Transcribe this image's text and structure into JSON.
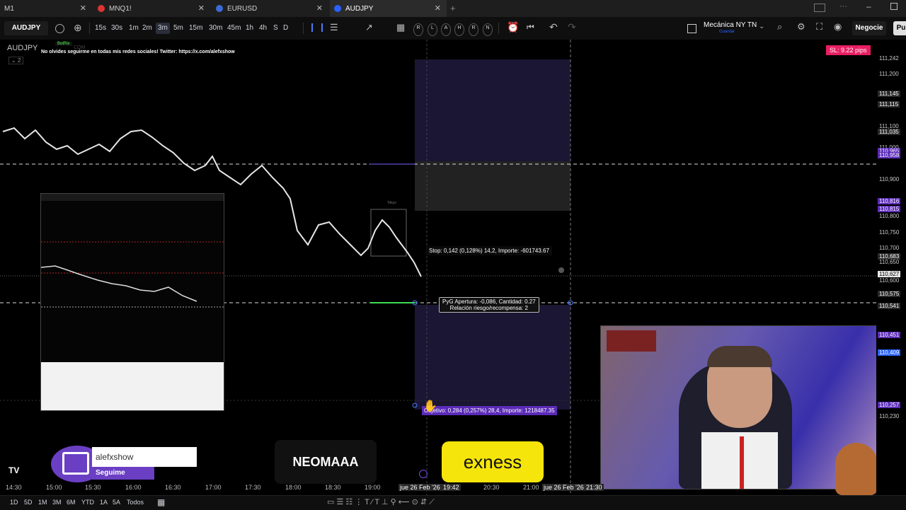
{
  "tabs": [
    {
      "label": "M1",
      "color": "#3a3a3a"
    },
    {
      "label": "MNQ1!",
      "color": "#2962ff"
    },
    {
      "label": "EURUSD",
      "color": "#2962ff"
    },
    {
      "label": "AUDJPY",
      "color": "#2962ff"
    }
  ],
  "toolbar": {
    "symbol": "AUDJPY",
    "intervals": [
      "15s",
      "30s",
      "1m",
      "2m",
      "3m",
      "5m",
      "15m",
      "30m",
      "45m",
      "1h",
      "4h",
      "S",
      "D"
    ],
    "active_interval": "3m",
    "drawing_letters": [
      "R",
      "L",
      "A",
      "H",
      "R",
      "N"
    ],
    "layout_name": "Mecánica NY TN",
    "layout_sub": "Guardar",
    "trade_button": "Negocie",
    "publish_button": "Pu"
  },
  "chart": {
    "legend_symbol": "AUDJPY",
    "legend_badge": "BotRix",
    "legend_small": "COM",
    "ticker_text": "No olvides seguirme en todas mis redes sociales! Twitter: https://x.com/alefxshow",
    "indicator_count": "2",
    "sl_badge": "SL: 9.22 pips",
    "stop_label": "Stop: 0,142 (0,128%) 14,2, Importe: -601743.67",
    "pyg_label_1": "PyG Apertura: -0,086, Cantidad: 0.27",
    "pyg_label_2": "Relación riesgo/recompensa: 2",
    "target_label": "Objetivo: 0,284 (0,257%) 28,4, Importe: 1218487.35",
    "session_label": "Tokyo"
  },
  "price_scale": [
    {
      "label": "111,242",
      "kind": "plain"
    },
    {
      "label": "111,200",
      "kind": "plain"
    },
    {
      "label": "111,145",
      "kind": "dark"
    },
    {
      "label": "111,115",
      "kind": "dark"
    },
    {
      "label": "111,100",
      "kind": "plain"
    },
    {
      "label": "111,035",
      "kind": "dark"
    },
    {
      "label": "111,000",
      "kind": "plain"
    },
    {
      "label": "110,965",
      "kind": "purple"
    },
    {
      "label": "110,958",
      "kind": "purple"
    },
    {
      "label": "110,900",
      "kind": "plain"
    },
    {
      "label": "110,816",
      "kind": "purple"
    },
    {
      "label": "110,815",
      "kind": "purple"
    },
    {
      "label": "110,800",
      "kind": "plain"
    },
    {
      "label": "110,750",
      "kind": "plain"
    },
    {
      "label": "110,700",
      "kind": "plain"
    },
    {
      "label": "110,683",
      "kind": "dark"
    },
    {
      "label": "110,650",
      "kind": "plain"
    },
    {
      "label": "110,627",
      "kind": "white"
    },
    {
      "label": "110,600",
      "kind": "plain"
    },
    {
      "label": "110,575",
      "kind": "dark"
    },
    {
      "label": "110,541",
      "kind": "dark"
    },
    {
      "label": "110,451",
      "kind": "purple"
    },
    {
      "label": "110,409",
      "kind": "blue"
    },
    {
      "label": "110,257",
      "kind": "purple"
    },
    {
      "label": "110,230",
      "kind": "plain"
    }
  ],
  "time_axis": [
    "14:30",
    "15:00",
    "15:30",
    "16:00",
    "16:30",
    "17:00",
    "17:30",
    "18:00",
    "18:30",
    "19:00",
    "jue 26 Feb '26",
    "19:42",
    "20:30",
    "21:00",
    "jue 26 Feb '26",
    "21:30"
  ],
  "bottom_bar": {
    "ranges": [
      "1D",
      "5D",
      "1M",
      "3M",
      "6M",
      "YTD",
      "1A",
      "5A",
      "Todos"
    ]
  },
  "overlay": {
    "twitch_user": "alefxshow",
    "twitch_follow": "Seguime",
    "sponsor_1": "NEOMAAA",
    "sponsor_2": "exness",
    "logo": "TV"
  },
  "colors": {
    "sl_badge": "#e91e63",
    "target_zone": "#1a1633",
    "stop_zone": "#2a2a2a",
    "exness_yellow": "#f5e50a",
    "twitch_purple": "#6a3fc4"
  }
}
